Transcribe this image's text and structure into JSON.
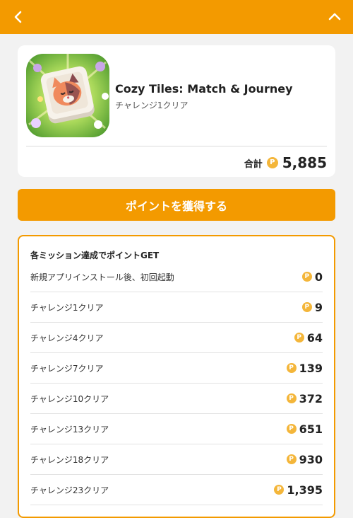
{
  "header": {
    "back_icon": "chevron-left-icon",
    "collapse_icon": "chevron-up-icon",
    "color": "#f39a00"
  },
  "app": {
    "name": "Cozy Tiles: Match & Journey",
    "subtitle": "チャレンジ1クリア",
    "icon": "cat-tile-app-icon"
  },
  "total": {
    "label": "合計",
    "coin_symbol": "P",
    "value": "5,885"
  },
  "cta": {
    "label": "ポイントを獲得する"
  },
  "missions": {
    "title": "各ミッション達成でポイントGET",
    "coin_symbol": "P",
    "items": [
      {
        "label": "新規アプリインストール後、初回起動",
        "points": "0"
      },
      {
        "label": "チャレンジ1クリア",
        "points": "9"
      },
      {
        "label": "チャレンジ4クリア",
        "points": "64"
      },
      {
        "label": "チャレンジ7クリア",
        "points": "139"
      },
      {
        "label": "チャレンジ10クリア",
        "points": "372"
      },
      {
        "label": "チャレンジ13クリア",
        "points": "651"
      },
      {
        "label": "チャレンジ18クリア",
        "points": "930"
      },
      {
        "label": "チャレンジ23クリア",
        "points": "1,395"
      }
    ]
  },
  "colors": {
    "accent": "#f39a00",
    "coin": "#f4b63a",
    "background": "#f2f2f2"
  }
}
